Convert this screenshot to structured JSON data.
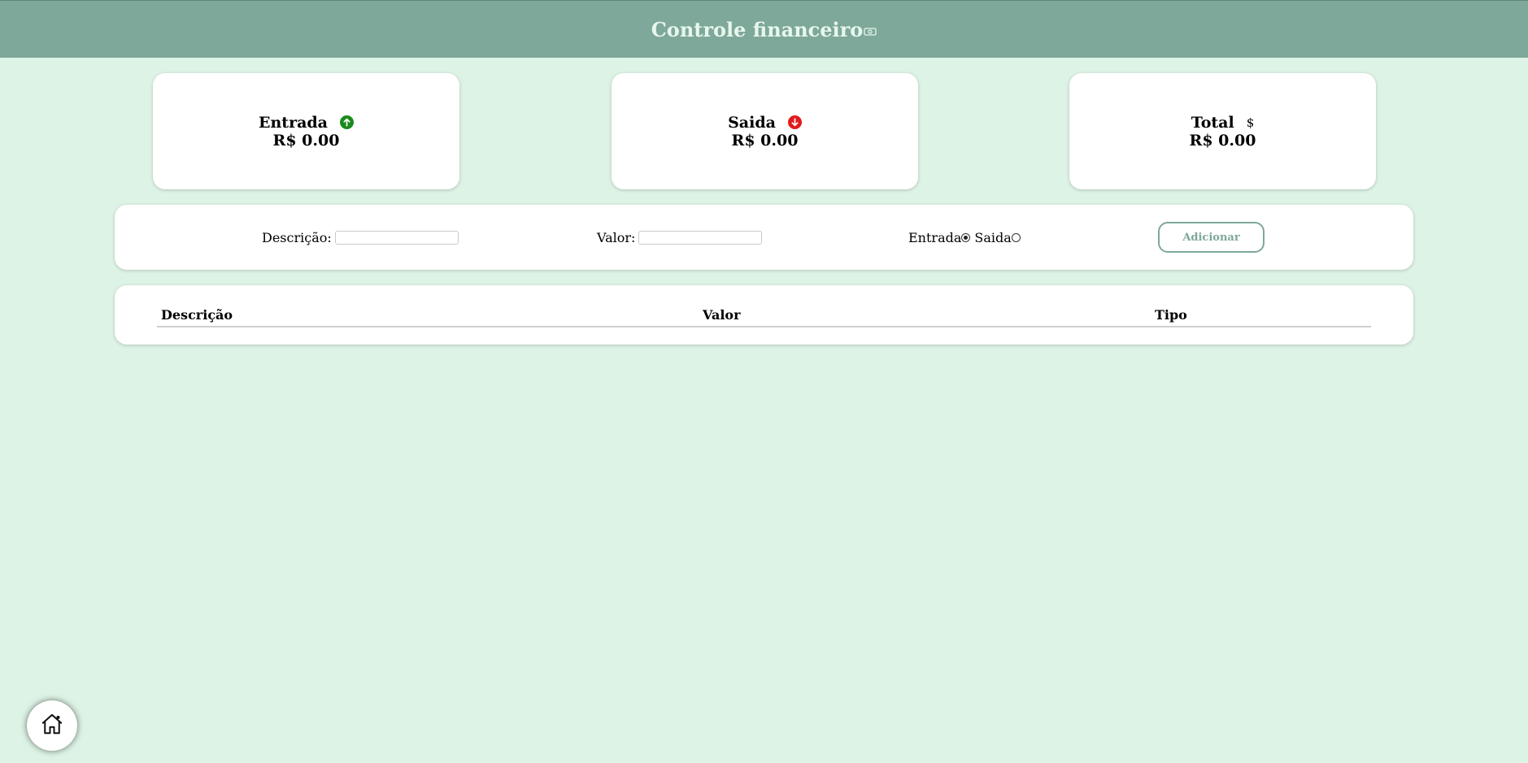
{
  "header": {
    "title": "Controle financeiro",
    "icon": "money-bill-icon"
  },
  "cards": {
    "entrada": {
      "label": "Entrada",
      "value": "R$ 0.00",
      "icon": "arrow-up-circle-icon",
      "icon_color": "#1b8a1b"
    },
    "saida": {
      "label": "Saida",
      "value": "R$ 0.00",
      "icon": "arrow-down-circle-icon",
      "icon_color": "#e01b1b"
    },
    "total": {
      "label": "Total",
      "value": "R$ 0.00",
      "icon": "dollar-icon"
    }
  },
  "form": {
    "descricao_label": "Descrição:",
    "descricao_value": "",
    "valor_label": "Valor:",
    "valor_value": "",
    "type_options": [
      {
        "label": "Entrada",
        "checked": true
      },
      {
        "label": "Saida",
        "checked": false
      }
    ],
    "add_button_label": "Adicionar"
  },
  "table": {
    "columns": [
      "Descrição",
      "Valor",
      "Tipo"
    ],
    "rows": []
  },
  "colors": {
    "header_bg": "#7ea899",
    "page_bg": "#ddf3e5",
    "accent": "#7ea899"
  },
  "home_button": {
    "icon": "home-icon"
  }
}
